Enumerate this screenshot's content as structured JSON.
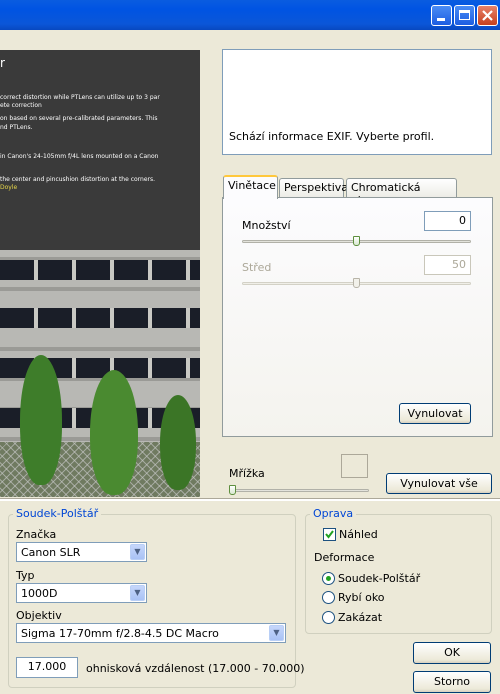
{
  "exif": {
    "message": "Schází informace EXIF. Vyberte profil."
  },
  "tabs": [
    "Vinětace",
    "Perspektiva",
    "Chromatická aberace"
  ],
  "vignette": {
    "amount_label": "Množství",
    "amount_value": "0",
    "amount_level": 0.5,
    "center_label": "Střed",
    "center_value": "50",
    "center_level": 0.5,
    "reset_label": "Vynulovat"
  },
  "grid": {
    "label": "Mřížka",
    "reset_all_label": "Vynulovat vše"
  },
  "preview": {
    "title_glyph": "r",
    "lines": [
      "correct distortion while PTLens can utilize up to 3 par",
      "ete correction",
      "on based on several pre-calibrated parameters. This",
      "nd PTLens.",
      "in Canon's 24-105mm f/4L lens mounted on a Canon",
      "the center and pincushion distortion at the corners.",
      "Doyle"
    ]
  },
  "barrel": {
    "title": "Soudek-Polštář",
    "brand_label": "Značka",
    "brand_value": "Canon SLR",
    "type_label": "Typ",
    "type_value": "1000D",
    "lens_label": "Objektiv",
    "lens_value": "Sigma 17-70mm f/2.8-4.5 DC Macro",
    "focal_value": "17.000",
    "focal_label": "ohnisková vzdálenost (17.000 - 70.000)"
  },
  "correction": {
    "title": "Oprava",
    "preview_label": "Náhled",
    "preview_checked": true,
    "deform_label": "Deformace",
    "options": [
      "Soudek-Polštář",
      "Rybí oko",
      "Zakázat"
    ],
    "selected": 0
  },
  "buttons": {
    "ok": "OK",
    "cancel": "Storno"
  }
}
